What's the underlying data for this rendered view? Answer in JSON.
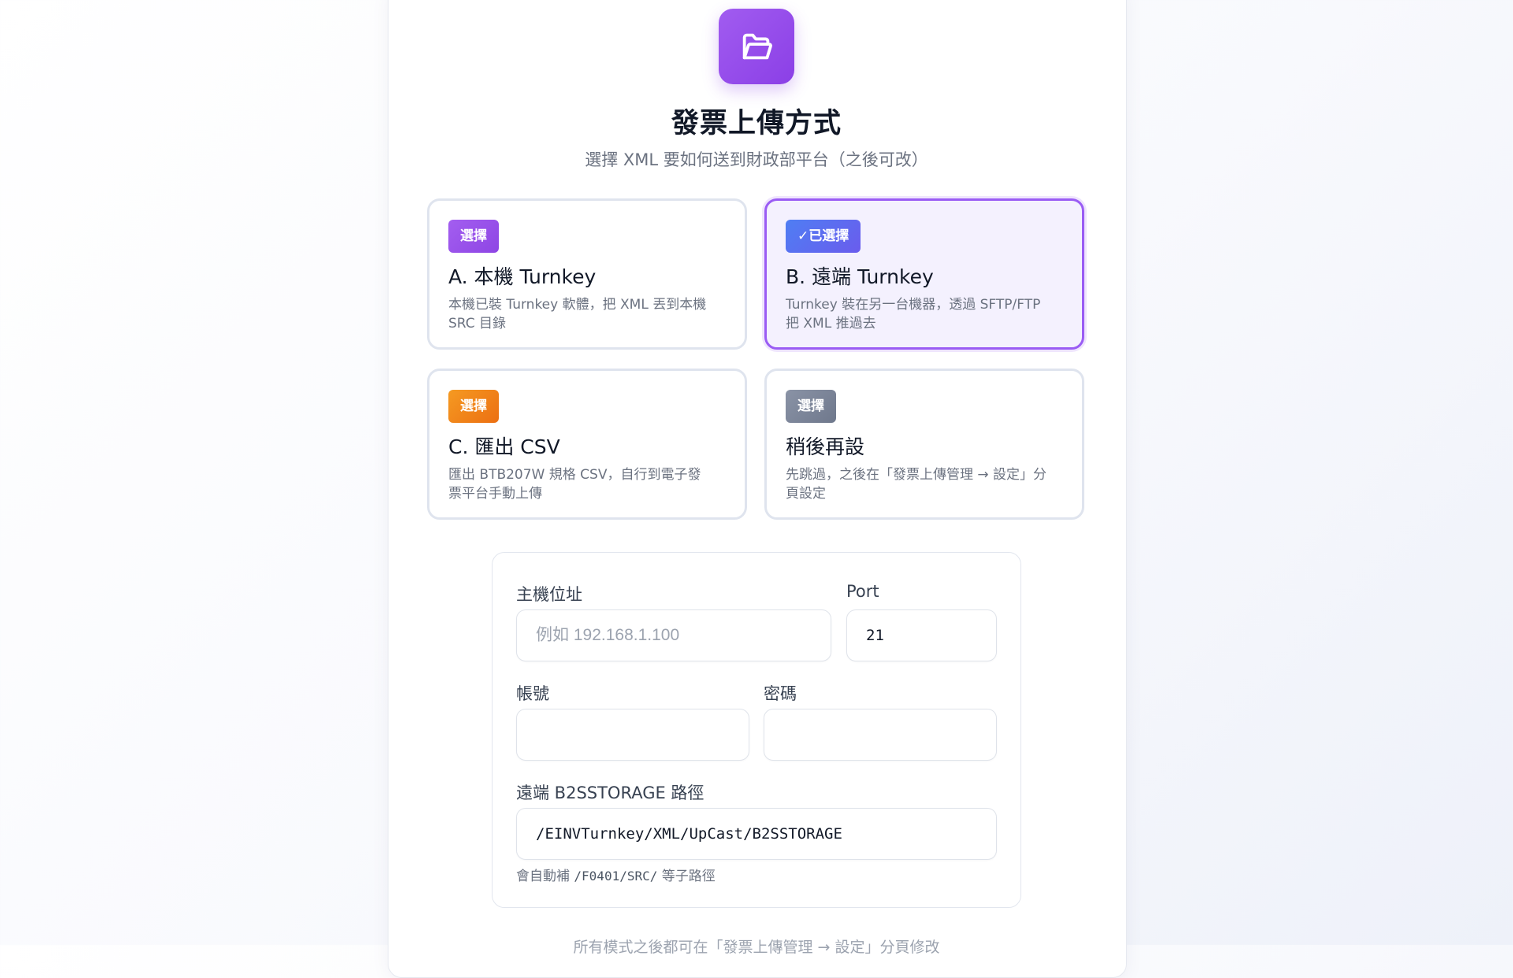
{
  "header": {
    "icon": "folder-open-icon",
    "title": "發票上傳方式",
    "subtitle": "選擇 XML 要如何送到財政部平台（之後可改）"
  },
  "options": [
    {
      "badge": "選擇",
      "title": "A. 本機 Turnkey",
      "desc": "本機已裝 Turnkey 軟體，把 XML 丟到本機 SRC 目錄",
      "color": "#9b59e8",
      "selected": false
    },
    {
      "badge": "✓已選擇",
      "title": "B. 遠端 Turnkey",
      "desc": "Turnkey 裝在另一台機器，透過 SFTP/FTP 把 XML 推過去",
      "color": "#5b6cf0",
      "selected": true
    },
    {
      "badge": "選擇",
      "title": "C. 匯出 CSV",
      "desc": "匯出 BTB207W 規格 CSV，自行到電子發票平台手動上傳",
      "color": "#f08a1c",
      "selected": false
    },
    {
      "badge": "選擇",
      "title": "稍後再設",
      "desc": "先跳過，之後在「發票上傳管理 → 設定」分頁設定",
      "color": "#7c8699",
      "selected": false
    }
  ],
  "form": {
    "host_label": "主機位址",
    "host_placeholder": "例如 192.168.1.100",
    "port_label": "Port",
    "port_value": "21",
    "user_label": "帳號",
    "user_value": "",
    "pass_label": "密碼",
    "pass_value": "",
    "path_label": "遠端 B2SSTORAGE 路徑",
    "path_value": "/EINVTurnkey/XML/UpCast/B2SSTORAGE",
    "hint_prefix": "會自動補",
    "hint_code": "/F0401/SRC/",
    "hint_suffix": "等子路徑"
  },
  "footer": "所有模式之後都可在「發票上傳管理 → 設定」分頁修改"
}
